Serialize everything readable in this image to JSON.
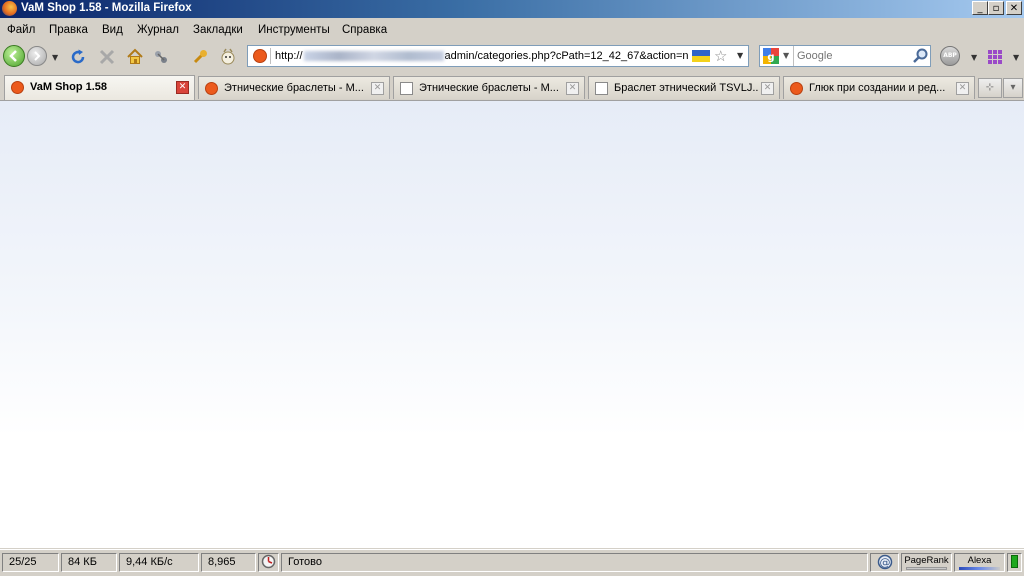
{
  "window": {
    "title": "VaM Shop 1.58 - Mozilla Firefox",
    "buttons": {
      "minimize": "_",
      "maximize": "▫",
      "close": "✕"
    }
  },
  "menu": [
    "Файл",
    "Правка",
    "Вид",
    "Журнал",
    "Закладки",
    "Инструменты",
    "Справка"
  ],
  "navbar": {
    "url_prefix": "http://",
    "url_suffix": "admin/categories.php?cPath=12_42_67&action=n",
    "search_placeholder": "Google",
    "abp_label": "ABP"
  },
  "tabs": [
    {
      "label": "VaM Shop 1.58",
      "icon": "site-favicon",
      "active": true
    },
    {
      "label": "Этнические браслеты - М...",
      "icon": "site-favicon",
      "active": false
    },
    {
      "label": "Этнические браслеты - М...",
      "icon": "page-icon",
      "active": false
    },
    {
      "label": "Браслет этнический TSVLJ...",
      "icon": "page-icon",
      "active": false
    },
    {
      "label": "Глюк при создании и ред...",
      "icon": "site-favicon",
      "active": false
    }
  ],
  "statusbar": {
    "requests": "25/25",
    "size": "84 КБ",
    "speed": "9,44 КБ/с",
    "time": "8,965",
    "status": "Готово",
    "pagerank": "PageRank",
    "alexa": "Alexa"
  },
  "colors": {
    "titlebar_start": "#0a246a",
    "titlebar_end": "#a6caf0",
    "chrome": "#d4d0c8",
    "close_active": "#d9443a"
  }
}
